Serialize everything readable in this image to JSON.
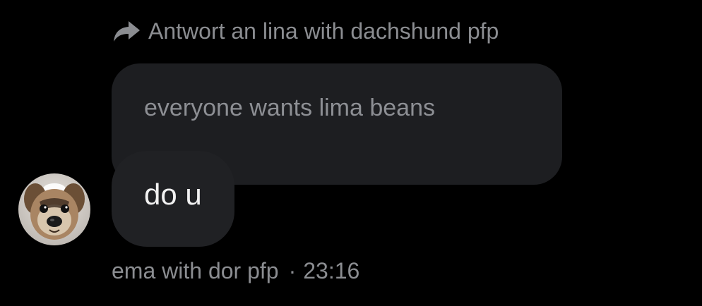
{
  "reply": {
    "icon": "reply-arrow-icon",
    "label": "Antwort an lina with dachshund pfp"
  },
  "quoted_message": {
    "text": "everyone wants lima beans"
  },
  "message": {
    "text": "do u"
  },
  "sender": {
    "avatar": "dog-avatar",
    "name": "ema with dor pfp",
    "separator": "·",
    "time": "23:16"
  },
  "colors": {
    "background": "#000000",
    "bubble": "#202124",
    "quoted_bubble": "#1d1e21",
    "muted_text": "#8b8d91",
    "text": "#f1f1f1"
  }
}
